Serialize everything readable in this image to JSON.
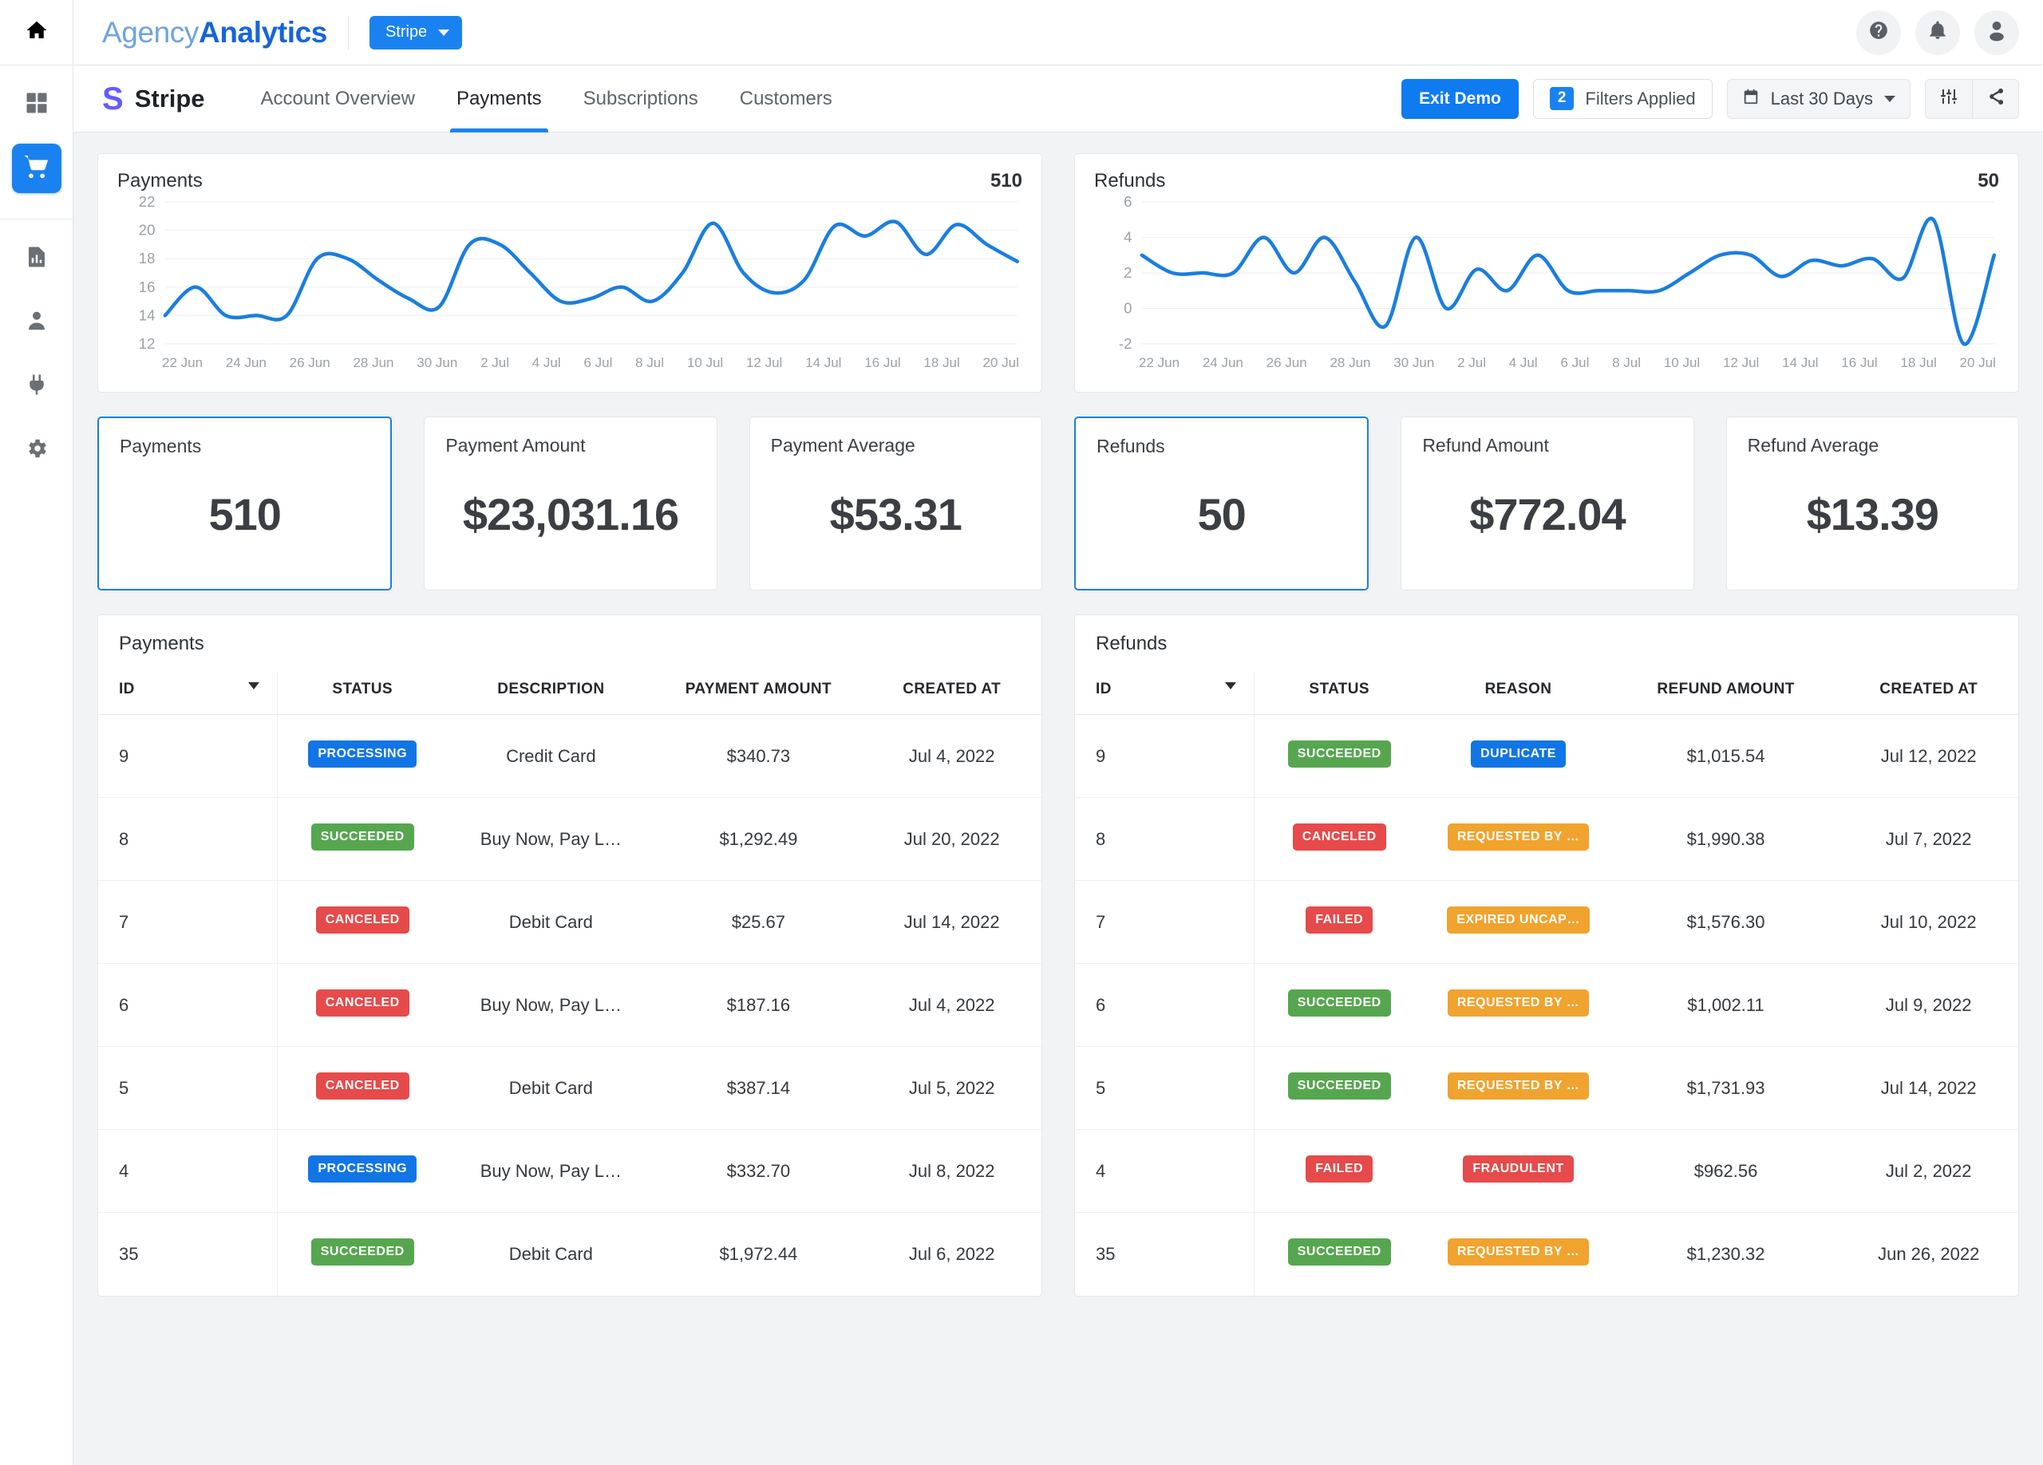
{
  "sidebar": {
    "items": [
      {
        "icon": "home-icon",
        "name": "home"
      },
      {
        "icon": "grid-icon",
        "name": "dashboard"
      },
      {
        "icon": "cart-icon",
        "name": "ecommerce",
        "active": true
      },
      {
        "icon": "report-icon",
        "name": "reports"
      },
      {
        "icon": "user-icon",
        "name": "clients"
      },
      {
        "icon": "plug-icon",
        "name": "integrations"
      },
      {
        "icon": "gear-icon",
        "name": "settings"
      }
    ]
  },
  "topbar": {
    "logo_part1": "Agency",
    "logo_part2": "Analytics",
    "account_button": "Stripe",
    "help_icon": "question-icon",
    "notifications_icon": "bell-icon",
    "avatar_icon": "avatar-icon"
  },
  "subbar": {
    "brand_mark": "S",
    "brand_name": "Stripe",
    "tabs": [
      {
        "label": "Account Overview",
        "active": false
      },
      {
        "label": "Payments",
        "active": true
      },
      {
        "label": "Subscriptions",
        "active": false
      },
      {
        "label": "Customers",
        "active": false
      }
    ],
    "exit_demo": "Exit Demo",
    "filters_count": "2",
    "filters_label": "Filters Applied",
    "date_range": "Last 30 Days",
    "date_icon": "calendar-icon",
    "settings_icon": "sliders-icon",
    "share_icon": "share-icon"
  },
  "charts": [
    {
      "title": "Payments",
      "total": "510"
    },
    {
      "title": "Refunds",
      "total": "50"
    }
  ],
  "chart_data": [
    {
      "type": "line",
      "title": "Payments",
      "total": 510,
      "xlabel": "",
      "ylabel": "",
      "ylim": [
        12,
        22
      ],
      "yticks": [
        12,
        14,
        16,
        18,
        20,
        22
      ],
      "grid": true,
      "legend": "none",
      "color": "#1a7ee0",
      "x": [
        "22 Jun",
        "23 Jun",
        "24 Jun",
        "25 Jun",
        "26 Jun",
        "27 Jun",
        "28 Jun",
        "29 Jun",
        "30 Jun",
        "1 Jul",
        "2 Jul",
        "3 Jul",
        "4 Jul",
        "5 Jul",
        "6 Jul",
        "7 Jul",
        "8 Jul",
        "9 Jul",
        "10 Jul",
        "11 Jul",
        "12 Jul",
        "13 Jul",
        "14 Jul",
        "15 Jul",
        "16 Jul",
        "17 Jul",
        "18 Jul",
        "19 Jul",
        "20 Jul"
      ],
      "xticks": [
        "22 Jun",
        "24 Jun",
        "26 Jun",
        "28 Jun",
        "30 Jun",
        "2 Jul",
        "4 Jul",
        "6 Jul",
        "8 Jul",
        "10 Jul",
        "12 Jul",
        "14 Jul",
        "16 Jul",
        "18 Jul",
        "20 Jul"
      ],
      "values": [
        14,
        16,
        14,
        14,
        14,
        18,
        18,
        16.5,
        15.2,
        14.6,
        19,
        19,
        17,
        15,
        15.2,
        16,
        15,
        17,
        20.5,
        17,
        15.6,
        16.5,
        20.3,
        19.6,
        20.6,
        18.3,
        20.4,
        19,
        17.8
      ]
    },
    {
      "type": "line",
      "title": "Refunds",
      "total": 50,
      "xlabel": "",
      "ylabel": "",
      "ylim": [
        -2,
        6
      ],
      "yticks": [
        -2,
        0,
        2,
        4,
        6
      ],
      "grid": true,
      "legend": "none",
      "color": "#1a7ee0",
      "x": [
        "22 Jun",
        "23 Jun",
        "24 Jun",
        "25 Jun",
        "26 Jun",
        "27 Jun",
        "28 Jun",
        "29 Jun",
        "30 Jun",
        "1 Jul",
        "2 Jul",
        "3 Jul",
        "4 Jul",
        "5 Jul",
        "6 Jul",
        "7 Jul",
        "8 Jul",
        "9 Jul",
        "10 Jul",
        "11 Jul",
        "12 Jul",
        "13 Jul",
        "14 Jul",
        "15 Jul",
        "16 Jul",
        "17 Jul",
        "18 Jul",
        "19 Jul",
        "20 Jul"
      ],
      "xticks": [
        "22 Jun",
        "24 Jun",
        "26 Jun",
        "28 Jun",
        "30 Jun",
        "2 Jul",
        "4 Jul",
        "6 Jul",
        "8 Jul",
        "10 Jul",
        "12 Jul",
        "14 Jul",
        "16 Jul",
        "18 Jul",
        "20 Jul"
      ],
      "values": [
        3,
        2,
        2,
        2,
        4,
        2,
        4,
        1.5,
        -1,
        4,
        0,
        2.2,
        1,
        3,
        1,
        1,
        1,
        1,
        2,
        3,
        3,
        1.8,
        2.7,
        2.4,
        2.8,
        1.7,
        5,
        -2,
        3
      ]
    }
  ],
  "kpis": [
    {
      "label": "Payments",
      "value": "510",
      "selected": true
    },
    {
      "label": "Payment Amount",
      "value": "$23,031.16",
      "selected": false
    },
    {
      "label": "Payment Average",
      "value": "$53.31",
      "selected": false
    },
    {
      "label": "Refunds",
      "value": "50",
      "selected": true
    },
    {
      "label": "Refund Amount",
      "value": "$772.04",
      "selected": false
    },
    {
      "label": "Refund Average",
      "value": "$13.39",
      "selected": false
    }
  ],
  "payments_table": {
    "title": "Payments",
    "columns": [
      "ID",
      "STATUS",
      "DESCRIPTION",
      "PAYMENT AMOUNT",
      "CREATED AT"
    ],
    "rows": [
      {
        "id": "9",
        "status": "PROCESSING",
        "status_color": "blue",
        "description": "Credit Card",
        "amount": "$340.73",
        "created": "Jul 4, 2022"
      },
      {
        "id": "8",
        "status": "SUCCEEDED",
        "status_color": "green",
        "description": "Buy Now, Pay L…",
        "amount": "$1,292.49",
        "created": "Jul 20, 2022"
      },
      {
        "id": "7",
        "status": "CANCELED",
        "status_color": "red",
        "description": "Debit Card",
        "amount": "$25.67",
        "created": "Jul 14, 2022"
      },
      {
        "id": "6",
        "status": "CANCELED",
        "status_color": "red",
        "description": "Buy Now, Pay L…",
        "amount": "$187.16",
        "created": "Jul 4, 2022"
      },
      {
        "id": "5",
        "status": "CANCELED",
        "status_color": "red",
        "description": "Debit Card",
        "amount": "$387.14",
        "created": "Jul 5, 2022"
      },
      {
        "id": "4",
        "status": "PROCESSING",
        "status_color": "blue",
        "description": "Buy Now, Pay L…",
        "amount": "$332.70",
        "created": "Jul 8, 2022"
      },
      {
        "id": "35",
        "status": "SUCCEEDED",
        "status_color": "green",
        "description": "Debit Card",
        "amount": "$1,972.44",
        "created": "Jul 6, 2022"
      }
    ]
  },
  "refunds_table": {
    "title": "Refunds",
    "columns": [
      "ID",
      "STATUS",
      "REASON",
      "REFUND AMOUNT",
      "CREATED AT"
    ],
    "rows": [
      {
        "id": "9",
        "status": "SUCCEEDED",
        "status_color": "green",
        "reason": "DUPLICATE",
        "reason_color": "blue",
        "amount": "$1,015.54",
        "created": "Jul 12, 2022"
      },
      {
        "id": "8",
        "status": "CANCELED",
        "status_color": "red",
        "reason": "REQUESTED BY …",
        "reason_color": "orange",
        "amount": "$1,990.38",
        "created": "Jul 7, 2022"
      },
      {
        "id": "7",
        "status": "FAILED",
        "status_color": "red",
        "reason": "EXPIRED UNCAP…",
        "reason_color": "orange",
        "amount": "$1,576.30",
        "created": "Jul 10, 2022"
      },
      {
        "id": "6",
        "status": "SUCCEEDED",
        "status_color": "green",
        "reason": "REQUESTED BY …",
        "reason_color": "orange",
        "amount": "$1,002.11",
        "created": "Jul 9, 2022"
      },
      {
        "id": "5",
        "status": "SUCCEEDED",
        "status_color": "green",
        "reason": "REQUESTED BY …",
        "reason_color": "orange",
        "amount": "$1,731.93",
        "created": "Jul 14, 2022"
      },
      {
        "id": "4",
        "status": "FAILED",
        "status_color": "red",
        "reason": "FRAUDULENT",
        "reason_color": "red",
        "amount": "$962.56",
        "created": "Jul 2, 2022"
      },
      {
        "id": "35",
        "status": "SUCCEEDED",
        "status_color": "green",
        "reason": "REQUESTED BY …",
        "reason_color": "orange",
        "amount": "$1,230.32",
        "created": "Jun 26, 2022"
      }
    ]
  },
  "colors": {
    "accent": "#1a82f0",
    "brand_blue": "#1565d8",
    "stripe_purple": "#635bff",
    "success": "#56a64f",
    "danger": "#e64a4a",
    "warning": "#f0a32e",
    "info": "#1275e6"
  }
}
